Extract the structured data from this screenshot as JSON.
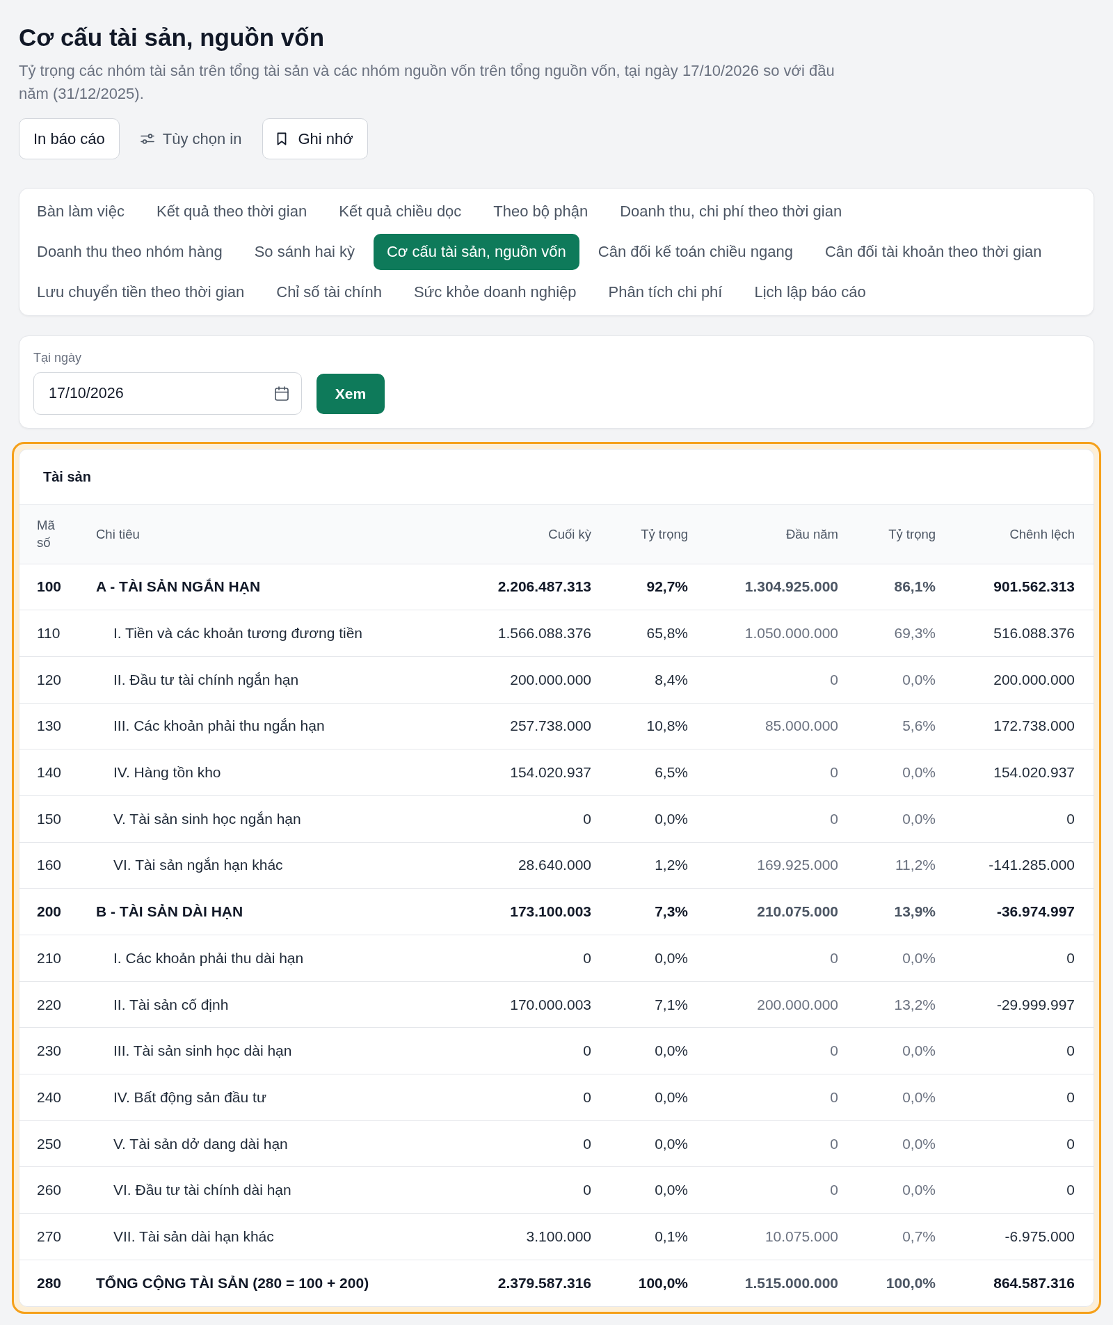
{
  "page": {
    "title": "Cơ cấu tài sản, nguồn vốn",
    "subtitle": "Tỷ trọng các nhóm tài sản trên tổng tài sản và các nhóm nguồn vốn trên tổng nguồn vốn, tại ngày 17/10/2026 so với đầu năm (31/12/2025)."
  },
  "actions": [
    {
      "label": "In báo cáo",
      "kind": "print"
    },
    {
      "label": "Tùy chọn in",
      "kind": "print_options"
    },
    {
      "label": "Ghi nhớ",
      "kind": "bookmark"
    }
  ],
  "tab_rows": [
    {
      "tabs": [
        {
          "label": "Bàn làm việc",
          "selected": false
        },
        {
          "label": "Kết quả theo thời gian",
          "selected": false
        },
        {
          "label": "Kết quả chiều dọc",
          "selected": false
        },
        {
          "label": "Theo bộ phận",
          "selected": false
        },
        {
          "label": "Doanh thu, chi phí theo thời gian",
          "selected": false
        }
      ]
    },
    {
      "tabs": [
        {
          "label": "Doanh thu theo nhóm hàng",
          "selected": false
        },
        {
          "label": "So sánh hai kỳ",
          "selected": false
        },
        {
          "label": "Cơ cấu tài sản, nguồn vốn",
          "selected": true
        },
        {
          "label": "Cân đối kế toán chiều ngang",
          "selected": false
        },
        {
          "label": "Cân đối tài khoản theo thời gian",
          "selected": false
        }
      ]
    },
    {
      "tabs": [
        {
          "label": "Lưu chuyển tiền theo thời gian",
          "selected": false
        },
        {
          "label": "Chỉ số tài chính",
          "selected": false
        },
        {
          "label": "Sức khỏe doanh nghiệp",
          "selected": false
        },
        {
          "label": "Phân tích chi phí",
          "selected": false
        },
        {
          "label": "Lịch lập báo cáo",
          "selected": false
        }
      ]
    }
  ],
  "filter": {
    "label": "Tại ngày",
    "date": "17/10/2026",
    "button": "Xem"
  },
  "table": {
    "title": "Tài sản",
    "highlighted": true,
    "columns": [
      {
        "label": "Mã số",
        "muted": false
      },
      {
        "label": "Chi tiêu",
        "muted": false
      },
      {
        "label": "Cuối kỳ",
        "muted": false
      },
      {
        "label": "Tỷ trọng",
        "muted": false
      },
      {
        "label": "Đầu năm",
        "muted": true
      },
      {
        "label": "Tỷ trọng",
        "muted": true
      },
      {
        "label": "Chênh lệch",
        "muted": false
      }
    ],
    "rows": [
      {
        "code": "100",
        "name": "A - TÀI SẢN NGẮN HẠN",
        "kind": "group",
        "values": [
          "2.206.487.313",
          "92,7%",
          "1.304.925.000",
          "86,1%",
          "901.562.313"
        ]
      },
      {
        "code": "110",
        "name": "I. Tiền và các khoản tương đương tiền",
        "kind": "item",
        "values": [
          "1.566.088.376",
          "65,8%",
          "1.050.000.000",
          "69,3%",
          "516.088.376"
        ]
      },
      {
        "code": "120",
        "name": "II. Đầu tư tài chính ngắn hạn",
        "kind": "item",
        "values": [
          "200.000.000",
          "8,4%",
          "0",
          "0,0%",
          "200.000.000"
        ]
      },
      {
        "code": "130",
        "name": "III. Các khoản phải thu ngắn hạn",
        "kind": "item",
        "values": [
          "257.738.000",
          "10,8%",
          "85.000.000",
          "5,6%",
          "172.738.000"
        ]
      },
      {
        "code": "140",
        "name": "IV. Hàng tồn kho",
        "kind": "item",
        "values": [
          "154.020.937",
          "6,5%",
          "0",
          "0,0%",
          "154.020.937"
        ]
      },
      {
        "code": "150",
        "name": "V. Tài sản sinh học ngắn hạn",
        "kind": "item",
        "values": [
          "0",
          "0,0%",
          "0",
          "0,0%",
          "0"
        ]
      },
      {
        "code": "160",
        "name": "VI. Tài sản ngắn hạn khác",
        "kind": "item",
        "values": [
          "28.640.000",
          "1,2%",
          "169.925.000",
          "11,2%",
          "-141.285.000"
        ]
      },
      {
        "code": "200",
        "name": "B - TÀI SẢN DÀI HẠN",
        "kind": "group",
        "values": [
          "173.100.003",
          "7,3%",
          "210.075.000",
          "13,9%",
          "-36.974.997"
        ]
      },
      {
        "code": "210",
        "name": "I. Các khoản phải thu dài hạn",
        "kind": "item",
        "values": [
          "0",
          "0,0%",
          "0",
          "0,0%",
          "0"
        ]
      },
      {
        "code": "220",
        "name": "II. Tài sản cố định",
        "kind": "item",
        "values": [
          "170.000.003",
          "7,1%",
          "200.000.000",
          "13,2%",
          "-29.999.997"
        ]
      },
      {
        "code": "230",
        "name": "III. Tài sản sinh học dài hạn",
        "kind": "item",
        "values": [
          "0",
          "0,0%",
          "0",
          "0,0%",
          "0"
        ]
      },
      {
        "code": "240",
        "name": "IV. Bất động sản đầu tư",
        "kind": "item",
        "values": [
          "0",
          "0,0%",
          "0",
          "0,0%",
          "0"
        ]
      },
      {
        "code": "250",
        "name": "V. Tài sản dở dang dài hạn",
        "kind": "item",
        "values": [
          "0",
          "0,0%",
          "0",
          "0,0%",
          "0"
        ]
      },
      {
        "code": "260",
        "name": "VI. Đầu tư tài chính dài hạn",
        "kind": "item",
        "values": [
          "0",
          "0,0%",
          "0",
          "0,0%",
          "0"
        ]
      },
      {
        "code": "270",
        "name": "VII. Tài sản dài hạn khác",
        "kind": "item",
        "values": [
          "3.100.000",
          "0,1%",
          "10.075.000",
          "0,7%",
          "-6.975.000"
        ]
      },
      {
        "code": "280",
        "name": "TỔNG CỘNG TÀI SẢN (280 = 100 + 200)",
        "kind": "total",
        "values": [
          "2.379.587.316",
          "100,0%",
          "1.515.000.000",
          "100,0%",
          "864.587.316"
        ]
      }
    ]
  }
}
